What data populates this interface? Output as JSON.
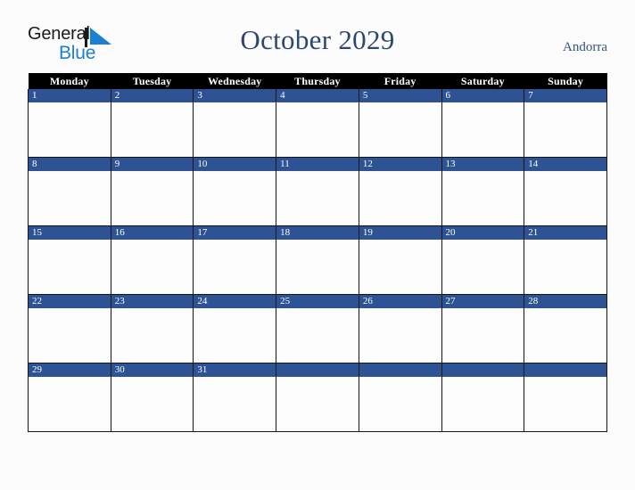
{
  "logo": {
    "word_one": "General",
    "word_two": "Blue",
    "mark": "triangle-mark",
    "color_dark": "#1a1a1a",
    "color_blue": "#1b7fd4"
  },
  "header": {
    "title": "October 2029",
    "month": "October",
    "year": "2029",
    "country": "Andorra",
    "title_color": "#2d4770",
    "country_color": "#31557f"
  },
  "calendar": {
    "first_day_of_week": "Monday",
    "header_background": "#000000",
    "header_text_color": "#ffffff",
    "date_band_color": "#2e5395",
    "cell_background": "#fdfdfd",
    "border_color": "#141414",
    "weekdays": [
      "Monday",
      "Tuesday",
      "Wednesday",
      "Thursday",
      "Friday",
      "Saturday",
      "Sunday"
    ],
    "weeks": [
      [
        "1",
        "2",
        "3",
        "4",
        "5",
        "6",
        "7"
      ],
      [
        "8",
        "9",
        "10",
        "11",
        "12",
        "13",
        "14"
      ],
      [
        "15",
        "16",
        "17",
        "18",
        "19",
        "20",
        "21"
      ],
      [
        "22",
        "23",
        "24",
        "25",
        "26",
        "27",
        "28"
      ],
      [
        "29",
        "30",
        "31",
        "",
        "",
        "",
        ""
      ]
    ]
  },
  "page": {
    "background": "#fcfcfd"
  }
}
